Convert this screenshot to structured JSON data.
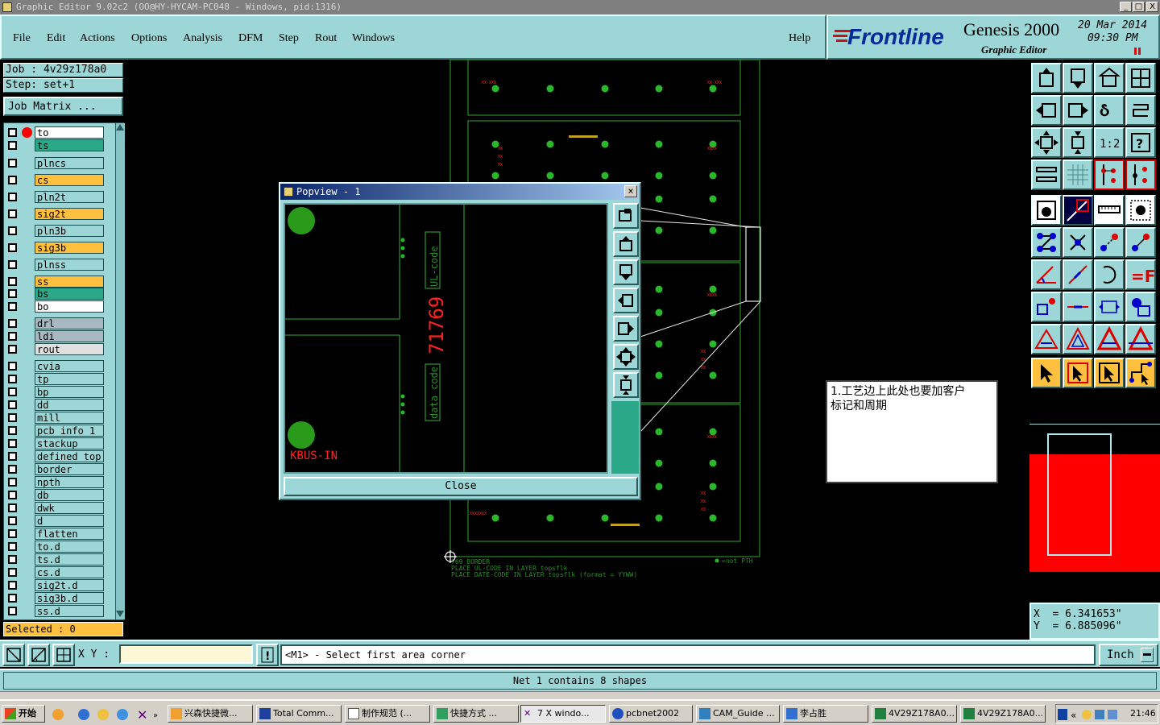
{
  "window": {
    "title": "Graphic Editor 9.02c2 (OO@HY-HYCAM-PC048 - Windows, pid:1316)",
    "min": "_",
    "restore": "□",
    "close": "X"
  },
  "menu": {
    "items": [
      "File",
      "Edit",
      "Actions",
      "Options",
      "Analysis",
      "DFM",
      "Step",
      "Rout",
      "Windows"
    ],
    "help": "Help"
  },
  "brand": {
    "logo": "Frontline",
    "product": "Genesis 2000",
    "subtitle": "Graphic Editor",
    "date": "20 Mar 2014",
    "time": "09:30 PM"
  },
  "job": {
    "job_label": "Job : 4v29z178a0",
    "step_label": "Step: set+1",
    "matrix_button": "Job Matrix ..."
  },
  "layers": [
    {
      "name": "to",
      "color": "#ffffff"
    },
    {
      "name": "ts",
      "color": "#2aa888"
    },
    {
      "name": "plncs",
      "color": "#9cd6d6"
    },
    {
      "name": "cs",
      "color": "#ffc040"
    },
    {
      "name": "pln2t",
      "color": "#9cd6d6"
    },
    {
      "name": "sig2t",
      "color": "#ffc040"
    },
    {
      "name": "pln3b",
      "color": "#9cd6d6"
    },
    {
      "name": "sig3b",
      "color": "#ffc040"
    },
    {
      "name": "plnss",
      "color": "#9cd6d6"
    },
    {
      "name": "ss",
      "color": "#ffc040"
    },
    {
      "name": "bs",
      "color": "#2aa888"
    },
    {
      "name": "bo",
      "color": "#ffffff"
    },
    {
      "name": "drl",
      "color": "#a8b8c0"
    },
    {
      "name": "ldi",
      "color": "#a8b8c0"
    },
    {
      "name": "rout",
      "color": "#e0e0e0"
    },
    {
      "name": "cvia",
      "color": "#9cd6d6"
    },
    {
      "name": "tp",
      "color": "#9cd6d6"
    },
    {
      "name": "bp",
      "color": "#9cd6d6"
    },
    {
      "name": "dd",
      "color": "#9cd6d6"
    },
    {
      "name": "mill",
      "color": "#9cd6d6"
    },
    {
      "name": "pcb_info_1",
      "color": "#9cd6d6"
    },
    {
      "name": "stackup",
      "color": "#9cd6d6"
    },
    {
      "name": "defined_top",
      "color": "#9cd6d6"
    },
    {
      "name": "border",
      "color": "#9cd6d6"
    },
    {
      "name": "npth",
      "color": "#9cd6d6"
    },
    {
      "name": "db",
      "color": "#9cd6d6"
    },
    {
      "name": "dwk",
      "color": "#9cd6d6"
    },
    {
      "name": "d",
      "color": "#9cd6d6"
    },
    {
      "name": "flatten",
      "color": "#9cd6d6"
    },
    {
      "name": "to.d",
      "color": "#9cd6d6"
    },
    {
      "name": "ts.d",
      "color": "#9cd6d6"
    },
    {
      "name": "cs.d",
      "color": "#9cd6d6"
    },
    {
      "name": "sig2t.d",
      "color": "#9cd6d6"
    },
    {
      "name": "sig3b.d",
      "color": "#9cd6d6"
    },
    {
      "name": "ss.d",
      "color": "#9cd6d6"
    }
  ],
  "selected": "Selected : 0",
  "popview": {
    "title": "Popview - 1",
    "close_label": "Close",
    "text_code": "71769",
    "text_ul": "UL-code",
    "text_date": "data code",
    "text_kbus": "KBUS-IN"
  },
  "board_texts": {
    "border_line": "769  BORDER",
    "note1": "PLACE UL-CODE IN LAYER topsflk",
    "note2": "PLACE DATE-CODE IN LAYER topsflk (format = YYWW)",
    "npth_legend": "=not PTH"
  },
  "note": {
    "line1": "1.工艺边上此处也要加客户",
    "line2": "标记和周期"
  },
  "coords": {
    "x": "X  = 6.341653\"",
    "y": "Y  = 6.885096\""
  },
  "command": {
    "xy_label": "X Y :",
    "xy_value": "",
    "prompt": "<M1> - Select first area corner",
    "units": "Inch"
  },
  "status": {
    "net": "Net 1 contains 8 shapes"
  },
  "taskbar": {
    "start": "开始",
    "tasks": [
      "兴森快捷微...",
      "Total Comm...",
      "制作规范 (...",
      "快捷方式 ...",
      "7 X windo...",
      "pcbnet2002",
      "CAM_Guide ...",
      "李占胜",
      "4V29Z178A0...",
      "4V29Z178A0..."
    ],
    "clock": "21:46"
  },
  "colors": {
    "accent": "#9cd6d6",
    "layer_orange": "#ffc040",
    "board_green": "#2a8a2a",
    "board_red": "#ff2020"
  }
}
